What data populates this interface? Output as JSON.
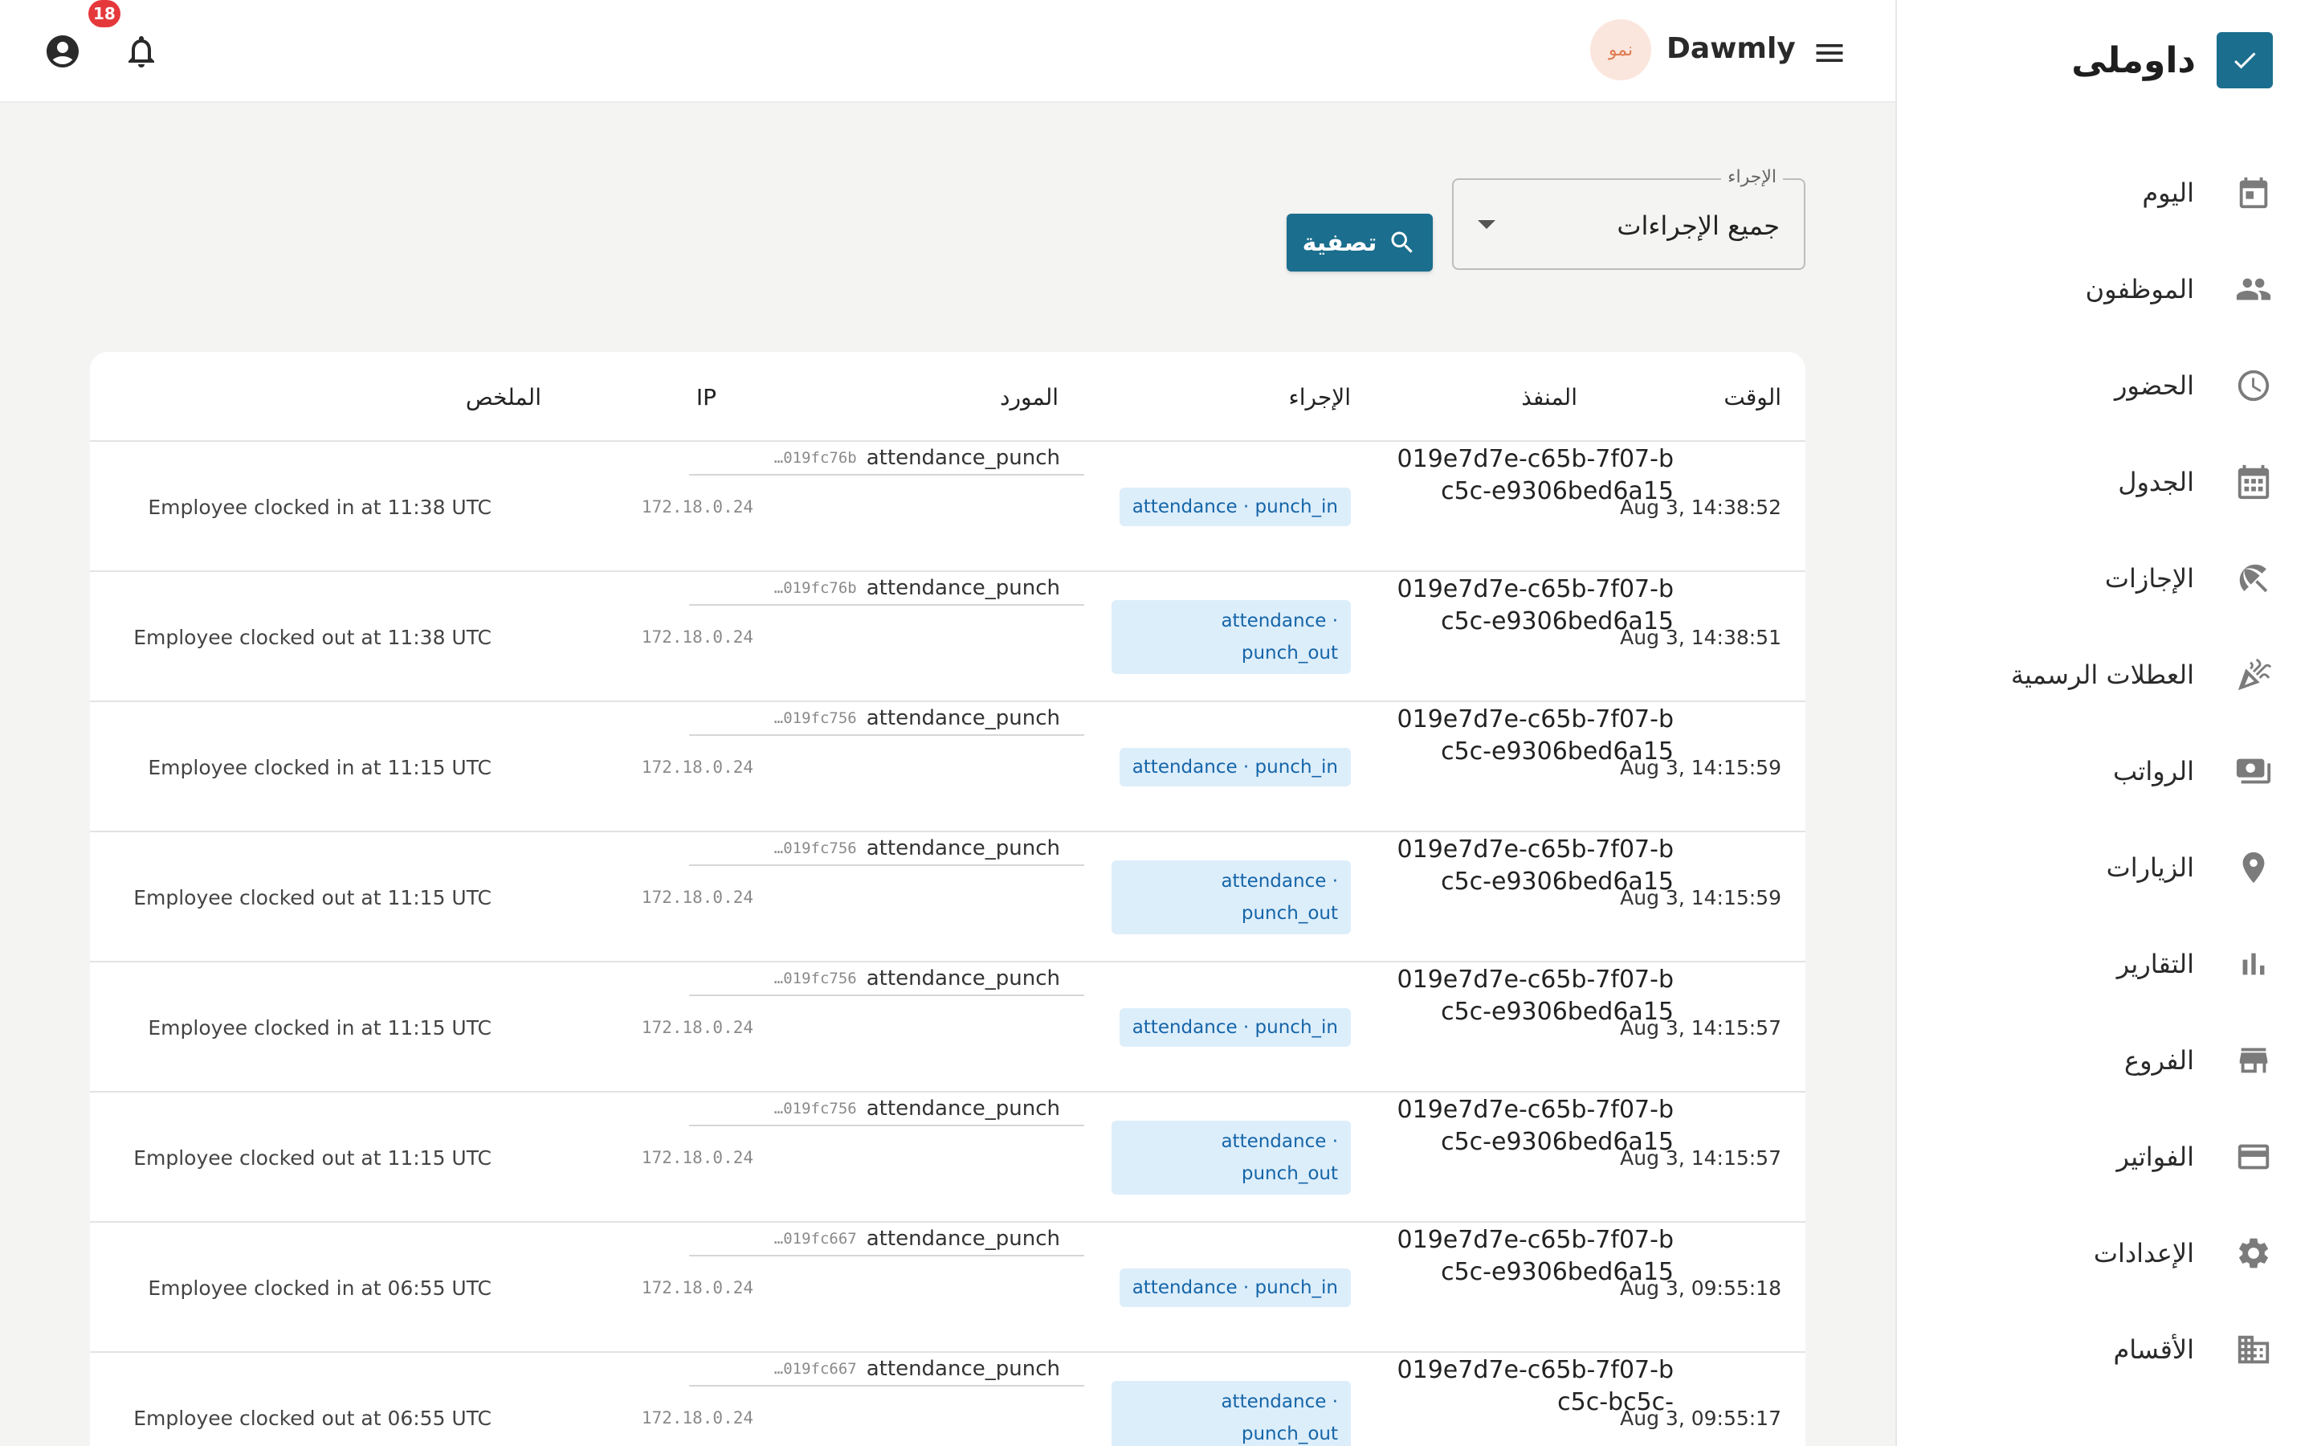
{
  "brand": {
    "name": "داوملى"
  },
  "nav": {
    "items": [
      {
        "label": "اليوم",
        "icon": "calendar-today-icon"
      },
      {
        "label": "الموظفون",
        "icon": "people-icon"
      },
      {
        "label": "الحضور",
        "icon": "clock-icon"
      },
      {
        "label": "الجدول",
        "icon": "calendar-grid-icon"
      },
      {
        "label": "الإجازات",
        "icon": "beach-umbrella-icon"
      },
      {
        "label": "العطلات الرسمية",
        "icon": "celebration-icon"
      },
      {
        "label": "الرواتب",
        "icon": "payments-icon"
      },
      {
        "label": "الزيارات",
        "icon": "location-pin-icon"
      },
      {
        "label": "التقارير",
        "icon": "bar-chart-icon"
      },
      {
        "label": "الفروع",
        "icon": "store-icon"
      },
      {
        "label": "الفواتير",
        "icon": "credit-card-icon"
      },
      {
        "label": "الإعدادات",
        "icon": "gear-icon"
      },
      {
        "label": "الأقسام",
        "icon": "domain-icon"
      }
    ]
  },
  "topbar": {
    "company_name": "Dawmly",
    "avatar_text": "نمو",
    "notification_count": "18"
  },
  "filter": {
    "legend": "الإجراء",
    "value": "جميع الإجراءات",
    "button_label": "تصفية"
  },
  "table": {
    "headers": {
      "time": "الوقت",
      "actor": "المنفذ",
      "action": "الإجراء",
      "resource": "المورد",
      "ip": "IP",
      "summary": "الملخص"
    },
    "rows": [
      {
        "time": "Aug 3, 14:38:52",
        "actor": "019e7d7e-c65b-7f07-bc5c-e9306bed6a15",
        "action": "attendance · punch_in",
        "resource_id": "…019fc76b",
        "resource_name": "attendance_punch",
        "ip": "172.18.0.24",
        "summary": "Employee clocked in at 11:38 UTC"
      },
      {
        "time": "Aug 3, 14:38:51",
        "actor": "019e7d7e-c65b-7f07-bc5c-e9306bed6a15",
        "action": "attendance · punch_out",
        "resource_id": "…019fc76b",
        "resource_name": "attendance_punch",
        "ip": "172.18.0.24",
        "summary": "Employee clocked out at 11:38 UTC"
      },
      {
        "time": "Aug 3, 14:15:59",
        "actor": "019e7d7e-c65b-7f07-bc5c-e9306bed6a15",
        "action": "attendance · punch_in",
        "resource_id": "…019fc756",
        "resource_name": "attendance_punch",
        "ip": "172.18.0.24",
        "summary": "Employee clocked in at 11:15 UTC"
      },
      {
        "time": "Aug 3, 14:15:59",
        "actor": "019e7d7e-c65b-7f07-bc5c-e9306bed6a15",
        "action": "attendance · punch_out",
        "resource_id": "…019fc756",
        "resource_name": "attendance_punch",
        "ip": "172.18.0.24",
        "summary": "Employee clocked out at 11:15 UTC"
      },
      {
        "time": "Aug 3, 14:15:57",
        "actor": "019e7d7e-c65b-7f07-bc5c-e9306bed6a15",
        "action": "attendance · punch_in",
        "resource_id": "…019fc756",
        "resource_name": "attendance_punch",
        "ip": "172.18.0.24",
        "summary": "Employee clocked in at 11:15 UTC"
      },
      {
        "time": "Aug 3, 14:15:57",
        "actor": "019e7d7e-c65b-7f07-bc5c-e9306bed6a15",
        "action": "attendance · punch_out",
        "resource_id": "…019fc756",
        "resource_name": "attendance_punch",
        "ip": "172.18.0.24",
        "summary": "Employee clocked out at 11:15 UTC"
      },
      {
        "time": "Aug 3, 09:55:18",
        "actor": "019e7d7e-c65b-7f07-bc5c-e9306bed6a15",
        "action": "attendance · punch_in",
        "resource_id": "…019fc667",
        "resource_name": "attendance_punch",
        "ip": "172.18.0.24",
        "summary": "Employee clocked in at 06:55 UTC"
      },
      {
        "time": "Aug 3, 09:55:17",
        "actor": "019e7d7e-c65b-7f07-bc5c-bc5c-",
        "action": "attendance · punch_out",
        "resource_id": "…019fc667",
        "resource_name": "attendance_punch",
        "ip": "172.18.0.24",
        "summary": "Employee clocked out at 06:55 UTC"
      }
    ]
  },
  "colors": {
    "primary": "#1b6e8e",
    "chip_bg": "#ddeefb",
    "chip_text": "#1565a8",
    "badge": "#e5383b"
  }
}
